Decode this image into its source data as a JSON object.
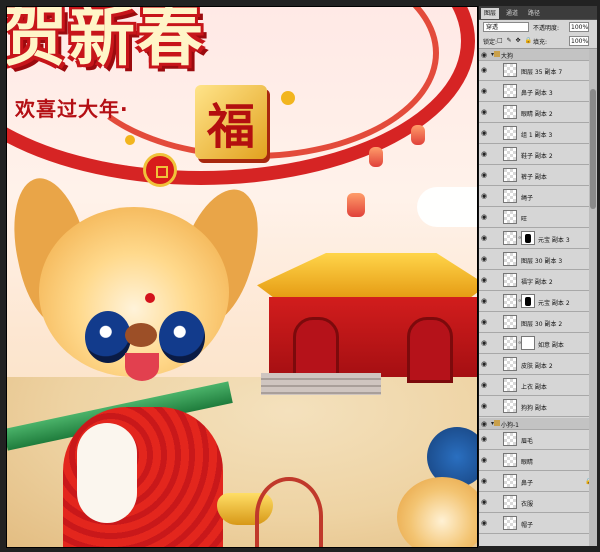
{
  "canvas": {
    "headline": "贺新春",
    "subline": "欢喜过大年·",
    "fu_char": "福"
  },
  "panel": {
    "tabs": [
      "图层",
      "通道",
      "路径"
    ],
    "active_tab": 0,
    "blend_mode": "穿透",
    "opacity_label": "不透明度:",
    "opacity_value": "100%",
    "lock_label": "锁定:",
    "lock_icons": "□ ✎ ✥ 🔒",
    "fill_label": "填充:",
    "fill_value": "100%",
    "layers": [
      {
        "name": "大狗",
        "type": "group"
      },
      {
        "name": "图层 35 副本 7",
        "type": "layer"
      },
      {
        "name": "鼻子 副本 3",
        "type": "layer"
      },
      {
        "name": "眼睛 副本 2",
        "type": "layer"
      },
      {
        "name": "组 1 副本 3",
        "type": "layer"
      },
      {
        "name": "鞋子 副本 2",
        "type": "layer"
      },
      {
        "name": "裤子 副本",
        "type": "layer"
      },
      {
        "name": "绳子",
        "type": "layer"
      },
      {
        "name": "旺",
        "type": "layer"
      },
      {
        "name": "元宝 副本 3",
        "type": "masked"
      },
      {
        "name": "图层 30 副本 3",
        "type": "layer"
      },
      {
        "name": "福字 副本 2",
        "type": "layer"
      },
      {
        "name": "元宝 副本 2",
        "type": "masked"
      },
      {
        "name": "图层 30 副本 2",
        "type": "layer"
      },
      {
        "name": "如意 副本",
        "type": "masked-light"
      },
      {
        "name": "皮肤 副本 2",
        "type": "layer"
      },
      {
        "name": "上衣 副本",
        "type": "layer"
      },
      {
        "name": "狗狗 副本",
        "type": "layer"
      },
      {
        "name": "小狗-1",
        "type": "group"
      },
      {
        "name": "眉毛",
        "type": "layer"
      },
      {
        "name": "眼睛",
        "type": "layer"
      },
      {
        "name": "鼻子",
        "type": "locked"
      },
      {
        "name": "衣服",
        "type": "layer"
      },
      {
        "name": "帽子",
        "type": "layer"
      }
    ]
  }
}
